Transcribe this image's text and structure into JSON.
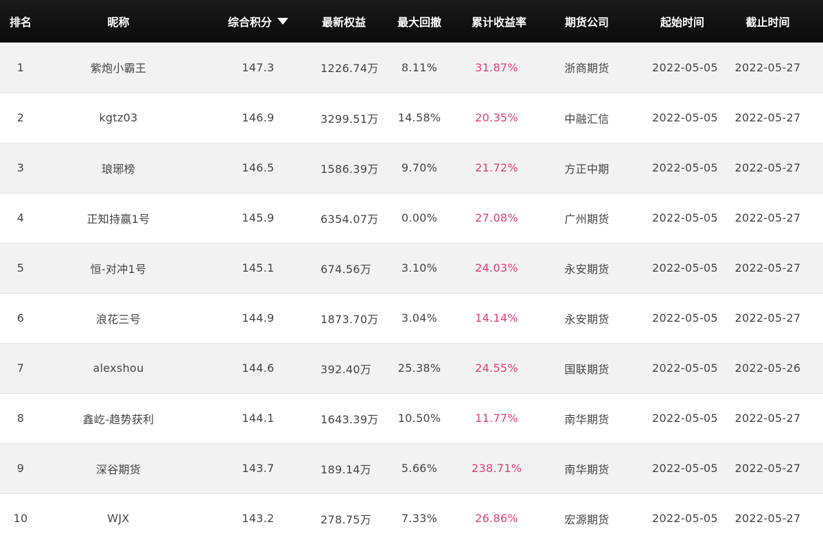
{
  "header": {
    "rank": "排名",
    "nickname": "昵称",
    "score": "综合积分",
    "equity": "最新权益",
    "drawdown": "最大回撤",
    "return": "累计收益率",
    "company": "期货公司",
    "start": "起始时间",
    "end": "截止时间"
  },
  "sort": {
    "column": "score",
    "direction": "desc",
    "icon": "sort-down-triangle-icon"
  },
  "colors": {
    "header_bg": "#111111",
    "return_text": "#e03c7a",
    "row_alt": "#f2f2f2"
  },
  "rows": [
    {
      "rank": "1",
      "nickname": "紫炮小霸王",
      "score": "147.3",
      "equity": "1226.74万",
      "drawdown": "8.11%",
      "return": "31.87%",
      "company": "浙商期货",
      "start": "2022-05-05",
      "end": "2022-05-27"
    },
    {
      "rank": "2",
      "nickname": "kgtz03",
      "score": "146.9",
      "equity": "3299.51万",
      "drawdown": "14.58%",
      "return": "20.35%",
      "company": "中融汇信",
      "start": "2022-05-05",
      "end": "2022-05-27"
    },
    {
      "rank": "3",
      "nickname": "琅琊榜",
      "score": "146.5",
      "equity": "1586.39万",
      "drawdown": "9.70%",
      "return": "21.72%",
      "company": "方正中期",
      "start": "2022-05-05",
      "end": "2022-05-27"
    },
    {
      "rank": "4",
      "nickname": "正知持赢1号",
      "score": "145.9",
      "equity": "6354.07万",
      "drawdown": "0.00%",
      "return": "27.08%",
      "company": "广州期货",
      "start": "2022-05-05",
      "end": "2022-05-27"
    },
    {
      "rank": "5",
      "nickname": "恒-对冲1号",
      "score": "145.1",
      "equity": "674.56万",
      "drawdown": "3.10%",
      "return": "24.03%",
      "company": "永安期货",
      "start": "2022-05-05",
      "end": "2022-05-27"
    },
    {
      "rank": "6",
      "nickname": "浪花三号",
      "score": "144.9",
      "equity": "1873.70万",
      "drawdown": "3.04%",
      "return": "14.14%",
      "company": "永安期货",
      "start": "2022-05-05",
      "end": "2022-05-27"
    },
    {
      "rank": "7",
      "nickname": "alexshou",
      "score": "144.6",
      "equity": "392.40万",
      "drawdown": "25.38%",
      "return": "24.55%",
      "company": "国联期货",
      "start": "2022-05-05",
      "end": "2022-05-26"
    },
    {
      "rank": "8",
      "nickname": "鑫屹-趋势获利",
      "score": "144.1",
      "equity": "1643.39万",
      "drawdown": "10.50%",
      "return": "11.77%",
      "company": "南华期货",
      "start": "2022-05-05",
      "end": "2022-05-27"
    },
    {
      "rank": "9",
      "nickname": "深谷期货",
      "score": "143.7",
      "equity": "189.14万",
      "drawdown": "5.66%",
      "return": "238.71%",
      "company": "南华期货",
      "start": "2022-05-05",
      "end": "2022-05-27"
    },
    {
      "rank": "10",
      "nickname": "WJX",
      "score": "143.2",
      "equity": "278.75万",
      "drawdown": "7.33%",
      "return": "26.86%",
      "company": "宏源期货",
      "start": "2022-05-05",
      "end": "2022-05-27"
    }
  ]
}
